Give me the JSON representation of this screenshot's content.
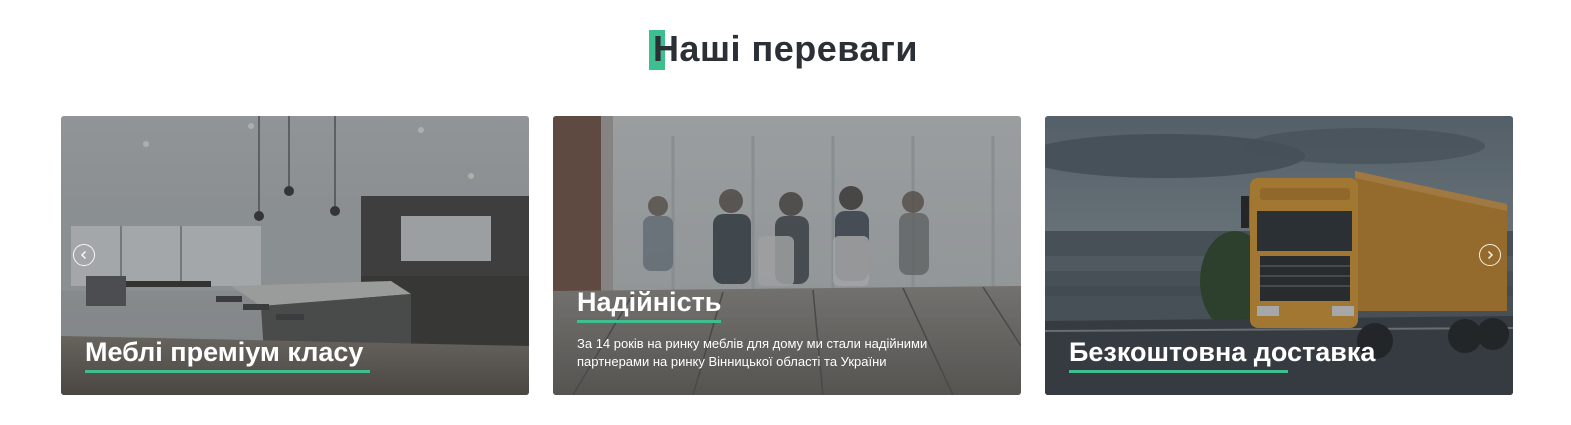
{
  "section": {
    "title": "Наші переваги"
  },
  "cards": [
    {
      "title": "Меблі преміум класу",
      "image": "modern-kitchen-interior"
    },
    {
      "title": "Надійність",
      "description": "За 14 років на ринку меблів для дому ми стали надійними партнерами на ринку Вінницької області та України",
      "image": "meeting-room-people"
    },
    {
      "title": "Безкоштовна доставка",
      "image": "orange-delivery-truck"
    }
  ],
  "icons": {
    "prev": "chevron-left-icon",
    "next": "chevron-right-icon"
  },
  "colors": {
    "accent": "#3fbf8f",
    "heading": "#2b2f36",
    "card_text": "#ffffff"
  }
}
